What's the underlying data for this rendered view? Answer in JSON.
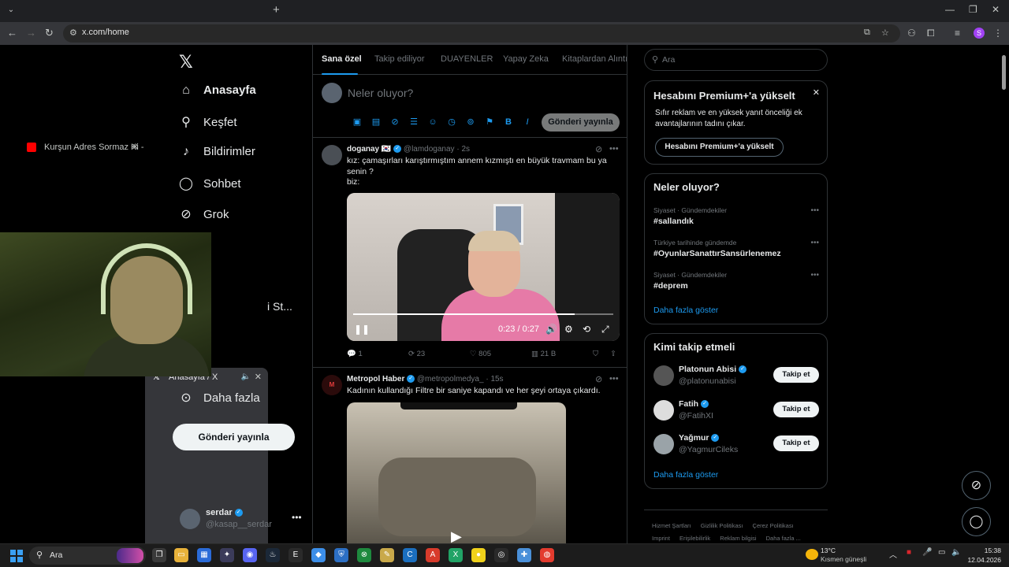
{
  "browser": {
    "tabs": [
      {
        "title": "Kurşun Adres Sormaz Ki - YouTube",
        "favicon": "youtube-icon"
      },
      {
        "title": "Anasayfa / X",
        "favicon": "x-logo-icon"
      }
    ],
    "url": "x.com/home"
  },
  "nav": {
    "items": [
      {
        "label": "Anasayfa",
        "icon": "home-icon"
      },
      {
        "label": "Keşfet",
        "icon": "search-icon"
      },
      {
        "label": "Bildirimler",
        "icon": "bell-icon"
      },
      {
        "label": "Sohbet",
        "icon": "chat-icon"
      },
      {
        "label": "Grok",
        "icon": "grok-icon"
      },
      {
        "label": "Daha fazla",
        "icon": "more-circle-icon"
      }
    ],
    "partial_item": "i St...",
    "post_button": "Gönderi yayınla",
    "account": {
      "name": "serdar",
      "handle": "@kasap__serdar"
    }
  },
  "feed": {
    "tabs": [
      "Sana özel",
      "Takip ediliyor",
      "DUAYENLER",
      "Yapay Zeka",
      "Kitaplardan Alıntı"
    ],
    "composer": {
      "placeholder": "Neler oluyor?",
      "post_button": "Gönderi yayınla"
    },
    "tweets": [
      {
        "name": "doganay",
        "flag": "🇰🇷",
        "handle": "@lamdoganay",
        "time": "2s",
        "text_lines": [
          "kız: çamaşırları karıştırmıştım annem kızmıştı en büyük travmam bu ya senin ?",
          "biz:"
        ],
        "video": {
          "time": "0:23 / 0:27",
          "progress": 0.85
        },
        "stats": {
          "replies": "1",
          "reposts": "23",
          "likes": "805",
          "views": "21 B"
        }
      },
      {
        "name": "Metropol Haber",
        "handle": "@metropolmedya_",
        "time": "15s",
        "text_lines": [
          "Kadının kullandığı Filtre bir saniye kapandı ve her şeyi ortaya çıkardı."
        ],
        "avatar_text": "M"
      }
    ]
  },
  "sidebar": {
    "search_placeholder": "Ara",
    "premium": {
      "title": "Hesabını Premium+'a yükselt",
      "desc": "Sıfır reklam ve en yüksek yanıt önceliği ek avantajlarının tadını çıkar.",
      "button": "Hesabını Premium+'a yükselt"
    },
    "trends": {
      "title": "Neler oluyor?",
      "items": [
        {
          "context": "Siyaset · Gündemdekiler",
          "tag": "#sallandık"
        },
        {
          "context": "Türkiye tarihinde gündemde",
          "tag": "#OyunlarSanattırSansürlenemez"
        },
        {
          "context": "Siyaset · Gündemdekiler",
          "tag": "#deprem"
        }
      ],
      "show_more": "Daha fazla göster"
    },
    "who_to_follow": {
      "title": "Kimi takip etmeli",
      "items": [
        {
          "name": "Platonun Abisi",
          "handle": "@platonunabisi",
          "button": "Takip et"
        },
        {
          "name": "Fatih",
          "handle": "@FatihXI",
          "button": "Takip et"
        },
        {
          "name": "Yağmur",
          "handle": "@YagmurCileks",
          "button": "Takip et"
        }
      ],
      "show_more": "Daha fazla göster"
    },
    "footer": [
      "Hizmet Şartları",
      "Gizlilik Politikası",
      "Çerez Politikası",
      "Imprint",
      "Erişilebilirlik",
      "Reklam bilgisi",
      "Daha fazla ..."
    ]
  },
  "taskbar": {
    "search_placeholder": "Ara",
    "weather": {
      "temp": "13°C",
      "desc": "Kısmen güneşli"
    },
    "time": "15:38",
    "date": "12.04.2026"
  },
  "colors": {
    "accent": "#1d9bf0",
    "background": "#000000",
    "border": "#2f3336",
    "muted": "#71767b"
  }
}
